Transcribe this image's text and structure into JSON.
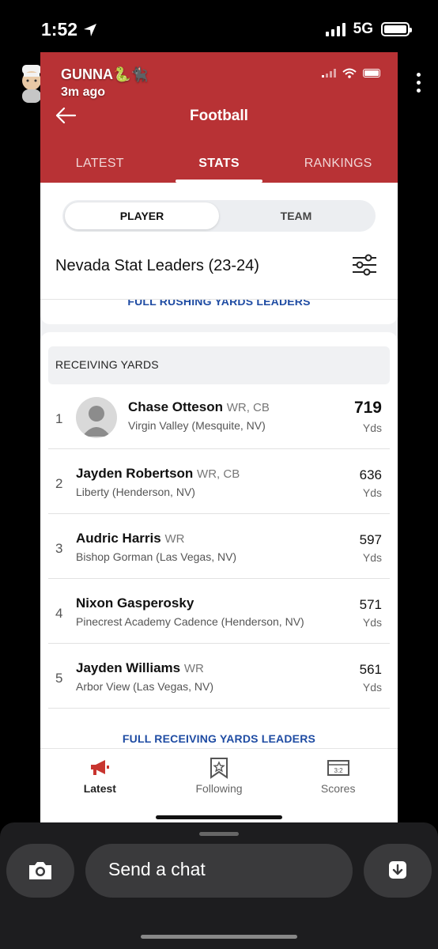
{
  "phone_status": {
    "time": "1:52",
    "network": "5G"
  },
  "snap": {
    "username": "GUNNA🐍🐈‍⬛",
    "posted_ago": "3m ago",
    "chat_placeholder": "Send a chat"
  },
  "app": {
    "title": "Football",
    "tabs": [
      {
        "label": "LATEST"
      },
      {
        "label": "STATS"
      },
      {
        "label": "RANKINGS"
      }
    ],
    "segments": [
      {
        "label": "PLAYER"
      },
      {
        "label": "TEAM"
      }
    ],
    "leaders_title": "Nevada Stat Leaders (23-24)",
    "prev_link": "FULL RUSHING YARDS LEADERS",
    "section": {
      "label": "RECEIVING YARDS",
      "rows": [
        {
          "rank": "1",
          "name": "Chase Otteson",
          "pos": "WR, CB",
          "school": "Virgin Valley (Mesquite, NV)",
          "value": "719",
          "unit": "Yds"
        },
        {
          "rank": "2",
          "name": "Jayden Robertson",
          "pos": "WR, CB",
          "school": "Liberty (Henderson, NV)",
          "value": "636",
          "unit": "Yds"
        },
        {
          "rank": "3",
          "name": "Audric Harris",
          "pos": "WR",
          "school": "Bishop Gorman (Las Vegas, NV)",
          "value": "597",
          "unit": "Yds"
        },
        {
          "rank": "4",
          "name": "Nixon Gasperosky",
          "pos": "",
          "school": "Pinecrest Academy Cadence (Henderson, NV)",
          "value": "571",
          "unit": "Yds"
        },
        {
          "rank": "5",
          "name": "Jayden Williams",
          "pos": "WR",
          "school": "Arbor View (Las Vegas, NV)",
          "value": "561",
          "unit": "Yds"
        }
      ],
      "full_link": "FULL RECEIVING YARDS LEADERS"
    },
    "bottom_nav": [
      {
        "label": "Latest",
        "icon": "megaphone-icon"
      },
      {
        "label": "Following",
        "icon": "bookmark-star-icon"
      },
      {
        "label": "Scores",
        "icon": "scoreboard-icon"
      }
    ],
    "colors": {
      "header": "#b83235",
      "link": "#1f4ca3"
    }
  }
}
